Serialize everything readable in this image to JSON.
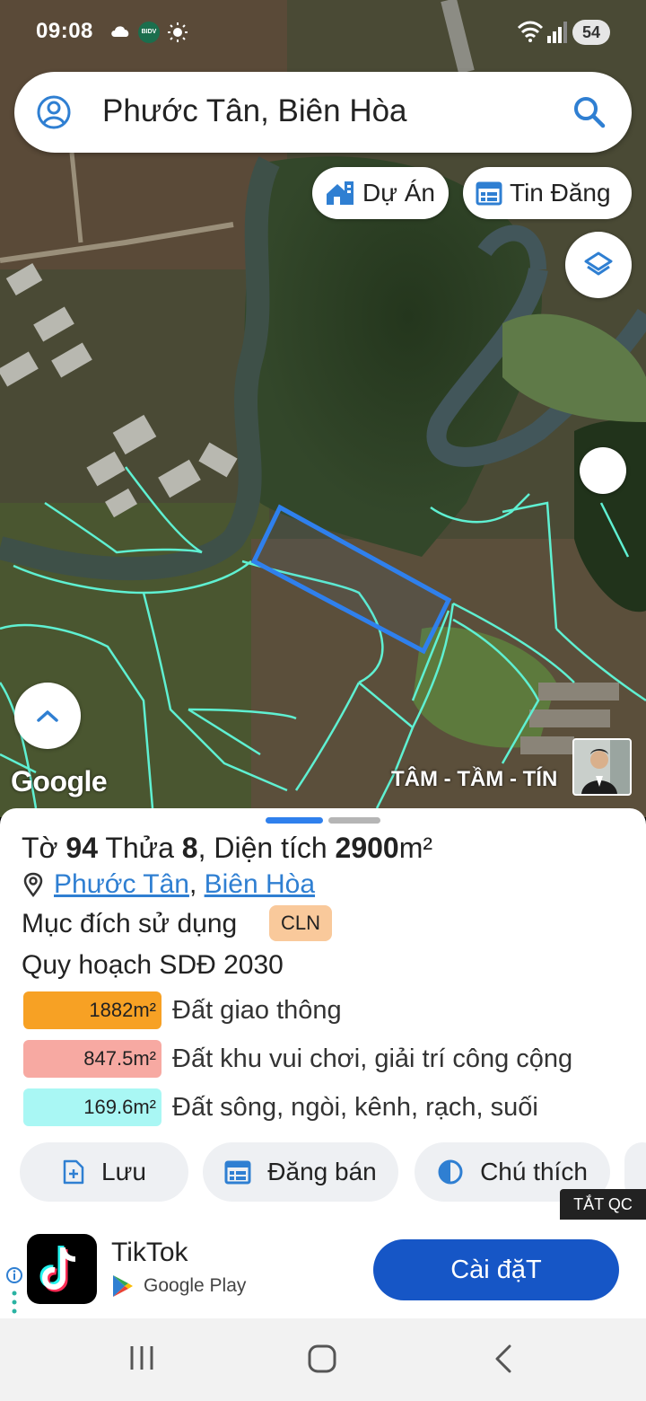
{
  "status_bar": {
    "time": "09:08",
    "bank_icon_text": "BIDV",
    "battery": "54"
  },
  "search": {
    "query": "Phước Tân, Biên Hòa"
  },
  "chips": {
    "projects": "Dự Án",
    "listings": "Tin Đăng"
  },
  "map": {
    "google_logo": "Google",
    "watermark": "TÂM - TẦM - TÍN",
    "parcel_color": "#2f80ed",
    "boundary_color": "#5ff0d2"
  },
  "parcel": {
    "sheet_label": "Tờ",
    "sheet_no": "94",
    "plot_label": "Thửa",
    "plot_no": "8",
    "area_label": ", Diện tích",
    "area": "2900",
    "area_unit": "m²",
    "ward": "Phước Tân",
    "city": "Biên Hòa",
    "purpose_label": "Mục đích sử dụng",
    "purpose_code": "CLN",
    "plan_label": "Quy hoạch SDĐ 2030",
    "zones": [
      {
        "area": "1882m²",
        "label": "Đất giao thông",
        "color": "#f7a124"
      },
      {
        "area": "847.5m²",
        "label": "Đất khu vui chơi, giải trí công cộng",
        "color": "#f7a9a2"
      },
      {
        "area": "169.6m²",
        "label": "Đất sông, ngòi, kênh, rạch, suối",
        "color": "#a9f7f4"
      }
    ]
  },
  "actions": {
    "save": "Lưu",
    "post": "Đăng bán",
    "legend": "Chú thích"
  },
  "ad": {
    "close": "TẮT QC",
    "app_name": "TikTok",
    "store": "Google Play",
    "cta": "Cài đặT"
  }
}
